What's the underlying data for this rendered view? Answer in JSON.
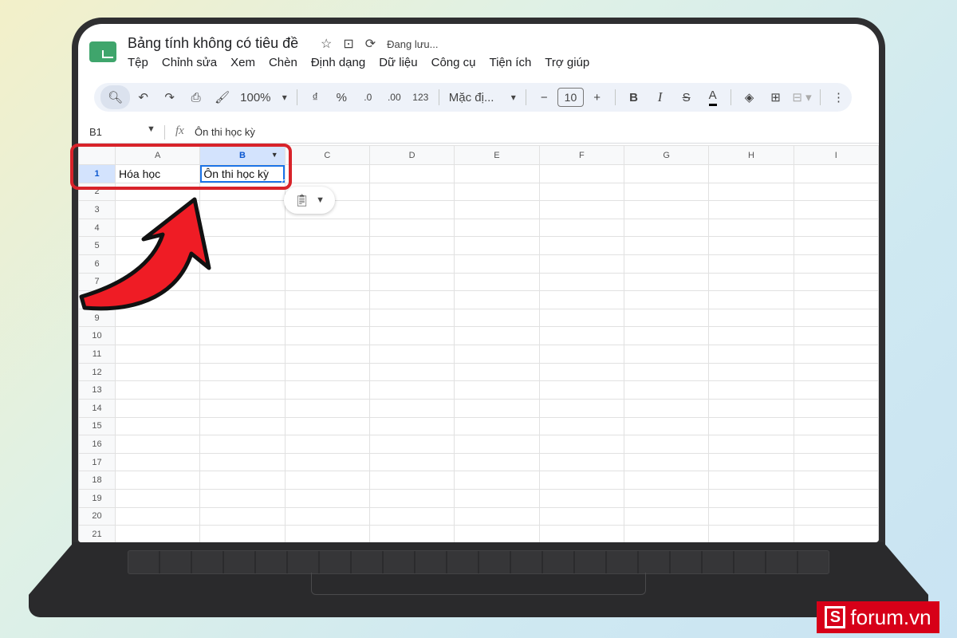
{
  "app": {
    "title": "Bảng tính không có tiêu đề",
    "saving_status": "Đang lưu...",
    "menu": [
      "Tệp",
      "Chỉnh sửa",
      "Xem",
      "Chèn",
      "Định dạng",
      "Dữ liệu",
      "Công cụ",
      "Tiện ích",
      "Trợ giúp"
    ]
  },
  "toolbar": {
    "zoom": "100%",
    "currency": "₫",
    "percent": "%",
    "decrease_decimal": ".0",
    "increase_decimal": ".00",
    "number_format": "123",
    "font": "Mặc đị...",
    "font_size": "10",
    "bold": "B",
    "italic": "I",
    "strikethrough": "S",
    "text_color": "A"
  },
  "formula_bar": {
    "name_box": "B1",
    "fx": "fx",
    "content": "Ôn thi học kỳ"
  },
  "grid": {
    "columns": [
      "A",
      "B",
      "C",
      "D",
      "E",
      "F",
      "G",
      "H",
      "I"
    ],
    "rows": [
      "1",
      "2",
      "3",
      "4",
      "5",
      "6",
      "7",
      "8",
      "9",
      "10",
      "11",
      "12",
      "13",
      "14",
      "15",
      "16",
      "17",
      "18",
      "19",
      "20",
      "21"
    ],
    "cells": {
      "A1": "Hóa học",
      "B1": "Ôn thi học kỳ"
    },
    "selected_cell": "B1"
  },
  "brand": {
    "letter": "S",
    "name": "forum.vn"
  },
  "colors": {
    "annotation": "#d8232a",
    "selection": "#1a73e8",
    "brand": "#d70018"
  },
  "icons": [
    "search-icon",
    "undo-icon",
    "redo-icon",
    "print-icon",
    "paint-format-icon",
    "star-icon",
    "move-folder-icon",
    "sync-icon",
    "fill-color-icon",
    "borders-icon",
    "merge-cells-icon",
    "more-icon",
    "clipboard-icon"
  ]
}
